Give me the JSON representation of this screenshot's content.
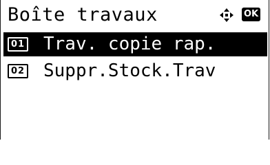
{
  "header": {
    "title": "Boîte travaux",
    "nav_icon": "up-down-left-right-arrows-icon",
    "ok_label": "OK"
  },
  "menu": {
    "items": [
      {
        "number": "01",
        "label": "Trav. copie rap.",
        "selected": true
      },
      {
        "number": "02",
        "label": "Suppr.Stock.Trav",
        "selected": false
      }
    ]
  },
  "colors": {
    "background": "#ffffff",
    "foreground": "#000000",
    "highlight": "#000000"
  }
}
